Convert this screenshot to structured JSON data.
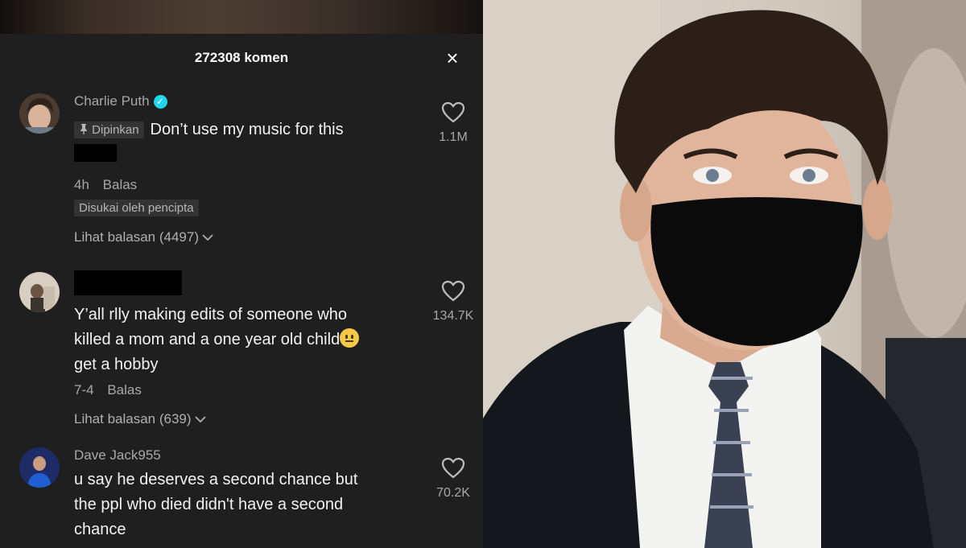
{
  "panel": {
    "title": "272308 komen",
    "close_symbol": "×"
  },
  "comments": [
    {
      "username": "Charlie Puth",
      "verified": true,
      "pinned_label": "Dipinkan",
      "text": "Don’t use my music for this",
      "time": "4h",
      "reply_label": "Balas",
      "creator_badge": "Disukai oleh pencipta",
      "view_replies": "Lihat balasan (4497)",
      "likes": "1.1M"
    },
    {
      "username": "",
      "text_line1": "Y’all rlly making edits of someone who",
      "text_line2": "killed a mom and a one year old child",
      "text_line3": "get a hobby",
      "time": "7-4",
      "reply_label": "Balas",
      "view_replies": "Lihat balasan (639)",
      "likes": "134.7K"
    },
    {
      "username": "Dave Jack955",
      "text_line1": "u say he deserves a second chance but",
      "text_line2": "the ppl who died didn't have a second",
      "text_line3": "chance",
      "likes": "70.2K"
    }
  ],
  "icons": {
    "heart": "heart-icon",
    "pin": "pin-icon",
    "verified": "verified-badge-icon",
    "chevron": "chevron-down-icon",
    "close": "close-icon"
  },
  "colors": {
    "panel_bg": "#1f1f1f",
    "verified": "#20d5ec",
    "text": "#f2f2f2",
    "muted": "#a8a8a8"
  }
}
